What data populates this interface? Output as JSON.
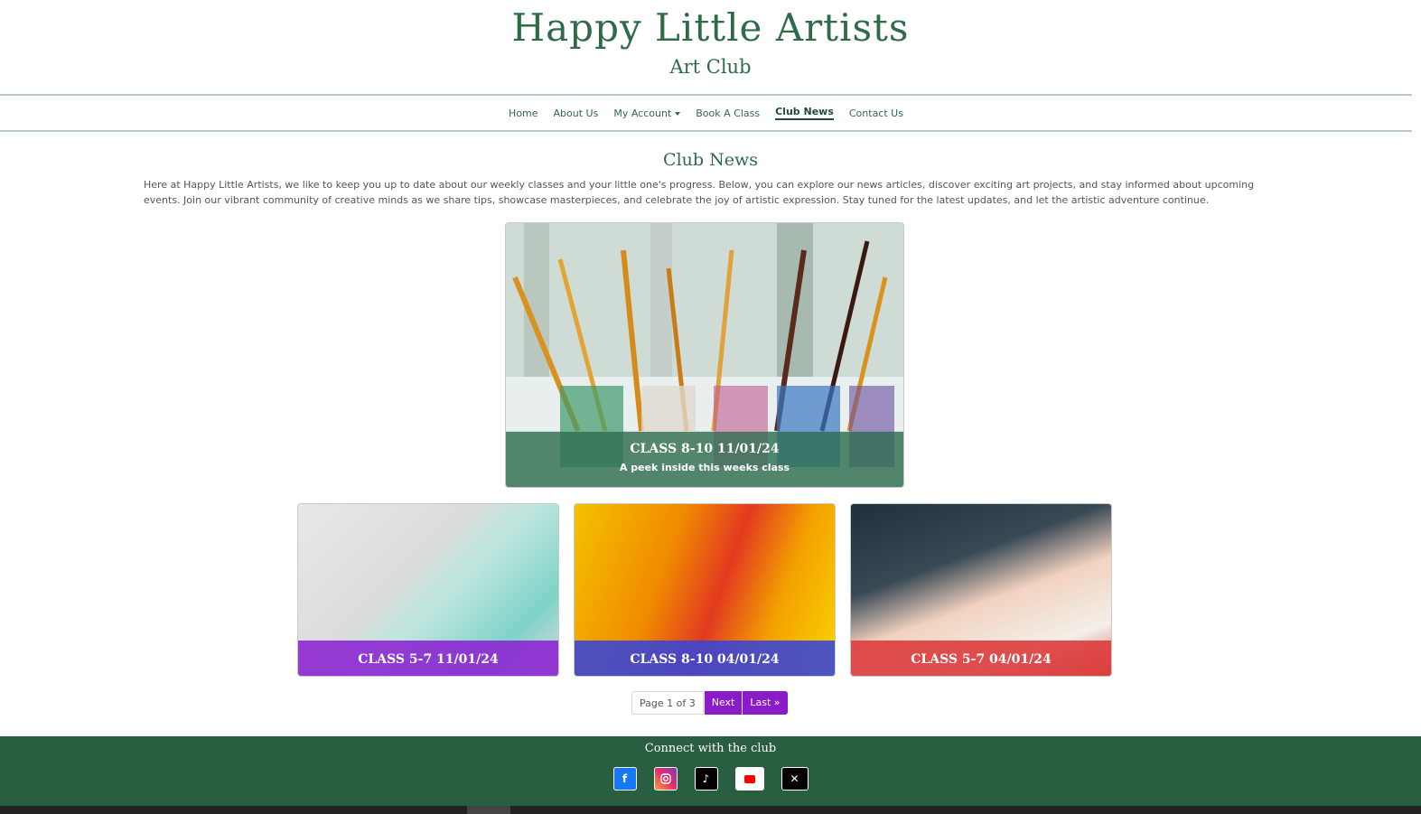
{
  "header": {
    "title": "Happy Little Artists",
    "subtitle": "Art Club"
  },
  "nav": {
    "items": [
      "Home",
      "About Us",
      "My Account",
      "Book A Class",
      "Club News",
      "Contact Us"
    ],
    "active": "Club News"
  },
  "main": {
    "title": "Club News",
    "intro": "Here at Happy Little Artists, we like to keep you up to date about our weekly classes and your little one's progress. Below, you can explore our news articles, discover exciting art projects, and stay informed about upcoming events. Join our vibrant community of creative minds as we share tips, showcase masterpieces, and celebrate the joy of artistic expression. Stay tuned for the latest updates, and let the artistic adventure continue."
  },
  "featured": {
    "title": "CLASS 8-10 11/01/24",
    "desc": "A peek inside this weeks class"
  },
  "cards": [
    {
      "title": "CLASS 5-7 11/01/24",
      "color": "#8c28d2"
    },
    {
      "title": "CLASS 8-10 04/01/24",
      "color": "#3c46d2"
    },
    {
      "title": "CLASS 5-7 04/01/24",
      "color": "#dc3c3c"
    }
  ],
  "pager": {
    "info": "Page 1 of 3",
    "next": "Next",
    "last": "Last »"
  },
  "footer": {
    "title": "Connect with the club",
    "social": [
      "facebook-icon",
      "instagram-icon",
      "tiktok-icon",
      "youtube-icon",
      "x-icon"
    ]
  },
  "colors": {
    "brand": "#2e6b46",
    "accent": "#8a1bc9",
    "footer": "#2a5e41"
  }
}
